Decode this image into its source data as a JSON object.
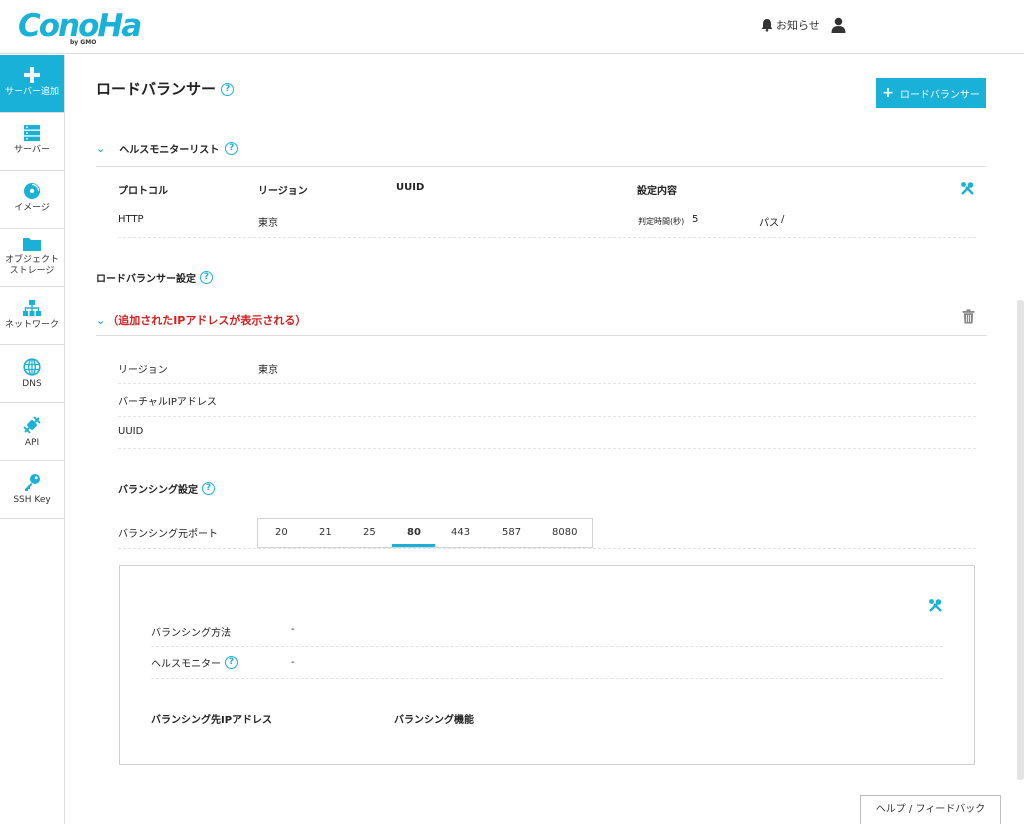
{
  "header": {
    "logo_text": "ConoHa",
    "logo_sub": "by GMO",
    "notice_label": "お知らせ"
  },
  "sidebar": {
    "items": [
      {
        "label": "サーバー追加",
        "icon": "plus-icon"
      },
      {
        "label": "サーバー",
        "icon": "server-icon"
      },
      {
        "label": "イメージ",
        "icon": "disc-icon"
      },
      {
        "label": "オブジェクト",
        "label2": "ストレージ",
        "icon": "folder-icon"
      },
      {
        "label": "ネットワーク",
        "icon": "network-icon"
      },
      {
        "label": "DNS",
        "icon": "globe-icon"
      },
      {
        "label": "API",
        "icon": "api-icon"
      },
      {
        "label": "SSH Key",
        "icon": "key-icon"
      }
    ]
  },
  "main": {
    "page_title": "ロードバランサー",
    "add_button": "ロードバランサー",
    "health_section": {
      "title": "ヘルスモニターリスト",
      "headers": [
        "プロトコル",
        "リージョン",
        "UUID",
        "設定内容"
      ],
      "row": {
        "protocol": "HTTP",
        "region": "東京",
        "uuid": "",
        "interval_label": "判定時間(秒)",
        "interval_value": "5",
        "path_label": "パス",
        "path_value": "/"
      }
    },
    "lb_settings_title": "ロードバランサー設定",
    "ip_section": {
      "title": "（追加されたIPアドレスが表示される）",
      "fields": [
        {
          "label": "リージョン",
          "value": "東京"
        },
        {
          "label": "バーチャルIPアドレス",
          "value": ""
        },
        {
          "label": "UUID",
          "value": ""
        }
      ]
    },
    "balancing": {
      "title": "バランシング設定",
      "port_label": "バランシング元ポート",
      "ports": [
        "20",
        "21",
        "25",
        "80",
        "443",
        "587",
        "8080"
      ],
      "selected_port": "80",
      "method_label": "バランシング方法",
      "method_value": "-",
      "monitor_label": "ヘルスモニター",
      "monitor_value": "-",
      "dest_ip_header": "バランシング先IPアドレス",
      "function_header": "バランシング機能"
    },
    "help_feedback": "ヘルプ / フィードバック"
  },
  "colors": {
    "accent": "#19b1d8",
    "warning": "#d2201e"
  }
}
